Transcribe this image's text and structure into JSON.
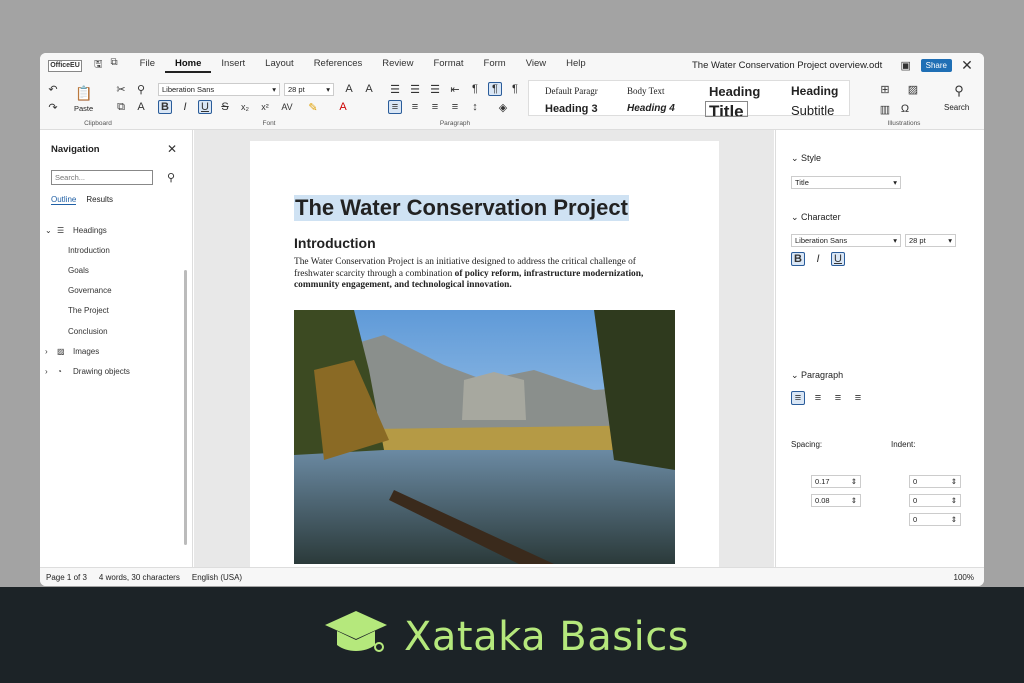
{
  "titlebar": {
    "logo": "OfficeEU",
    "doc_title": "The Water Conservation Project overview.odt",
    "share": "Share",
    "menu": [
      "File",
      "Home",
      "Insert",
      "Layout",
      "References",
      "Review",
      "Format",
      "Form",
      "View",
      "Help"
    ]
  },
  "ribbon": {
    "paste": "Paste",
    "font": "Liberation Sans",
    "size": "28 pt",
    "clipboard": "Clipboard",
    "font_group": "Font",
    "paragraph_group": "Paragraph",
    "illustrations": "Illustrations",
    "search": "Search",
    "styles": {
      "default": "Default Paragr",
      "body": "Body Text",
      "heading": "Heading",
      "heading_x": "Heading",
      "heading3": "Heading 3",
      "heading4": "Heading 4",
      "title": "Title",
      "subtitle": "Subtitle"
    }
  },
  "nav": {
    "title": "Navigation",
    "search_placeholder": "Search...",
    "tab_outline": "Outline",
    "tab_results": "Results",
    "headings": "Headings",
    "items": [
      "Introduction",
      "Goals",
      "Governance",
      "The Project",
      "Conclusion"
    ],
    "images": "Images",
    "drawing": "Drawing objects"
  },
  "page": {
    "title": "The Water Conservation Project",
    "h1": "Introduction",
    "body_plain": "The Water Conservation Project is an initiative designed to address the critical challenge of freshwater scarcity through a combination ",
    "body_bold": "of policy reform, infrastructure modernization, community engagement, and technological innovation."
  },
  "side": {
    "style": "Style",
    "style_val": "Title",
    "character": "Character",
    "font": "Liberation Sans",
    "size": "28 pt",
    "paragraph": "Paragraph",
    "spacing": "Spacing:",
    "indent": "Indent:",
    "sp1": "0.17",
    "sp2": "0.08",
    "in1": "0",
    "in2": "0",
    "in3": "0",
    "unit": "\""
  },
  "status": {
    "page": "Page 1 of 3",
    "words": "4 words, 30 characters",
    "lang": "English (USA)",
    "zoom": "100%"
  },
  "banner": {
    "text": "Xataka Basics"
  },
  "colors": {
    "accent": "#1f5fa5",
    "banner_bg": "#1c2327",
    "banner_text": "#b5e87c"
  }
}
